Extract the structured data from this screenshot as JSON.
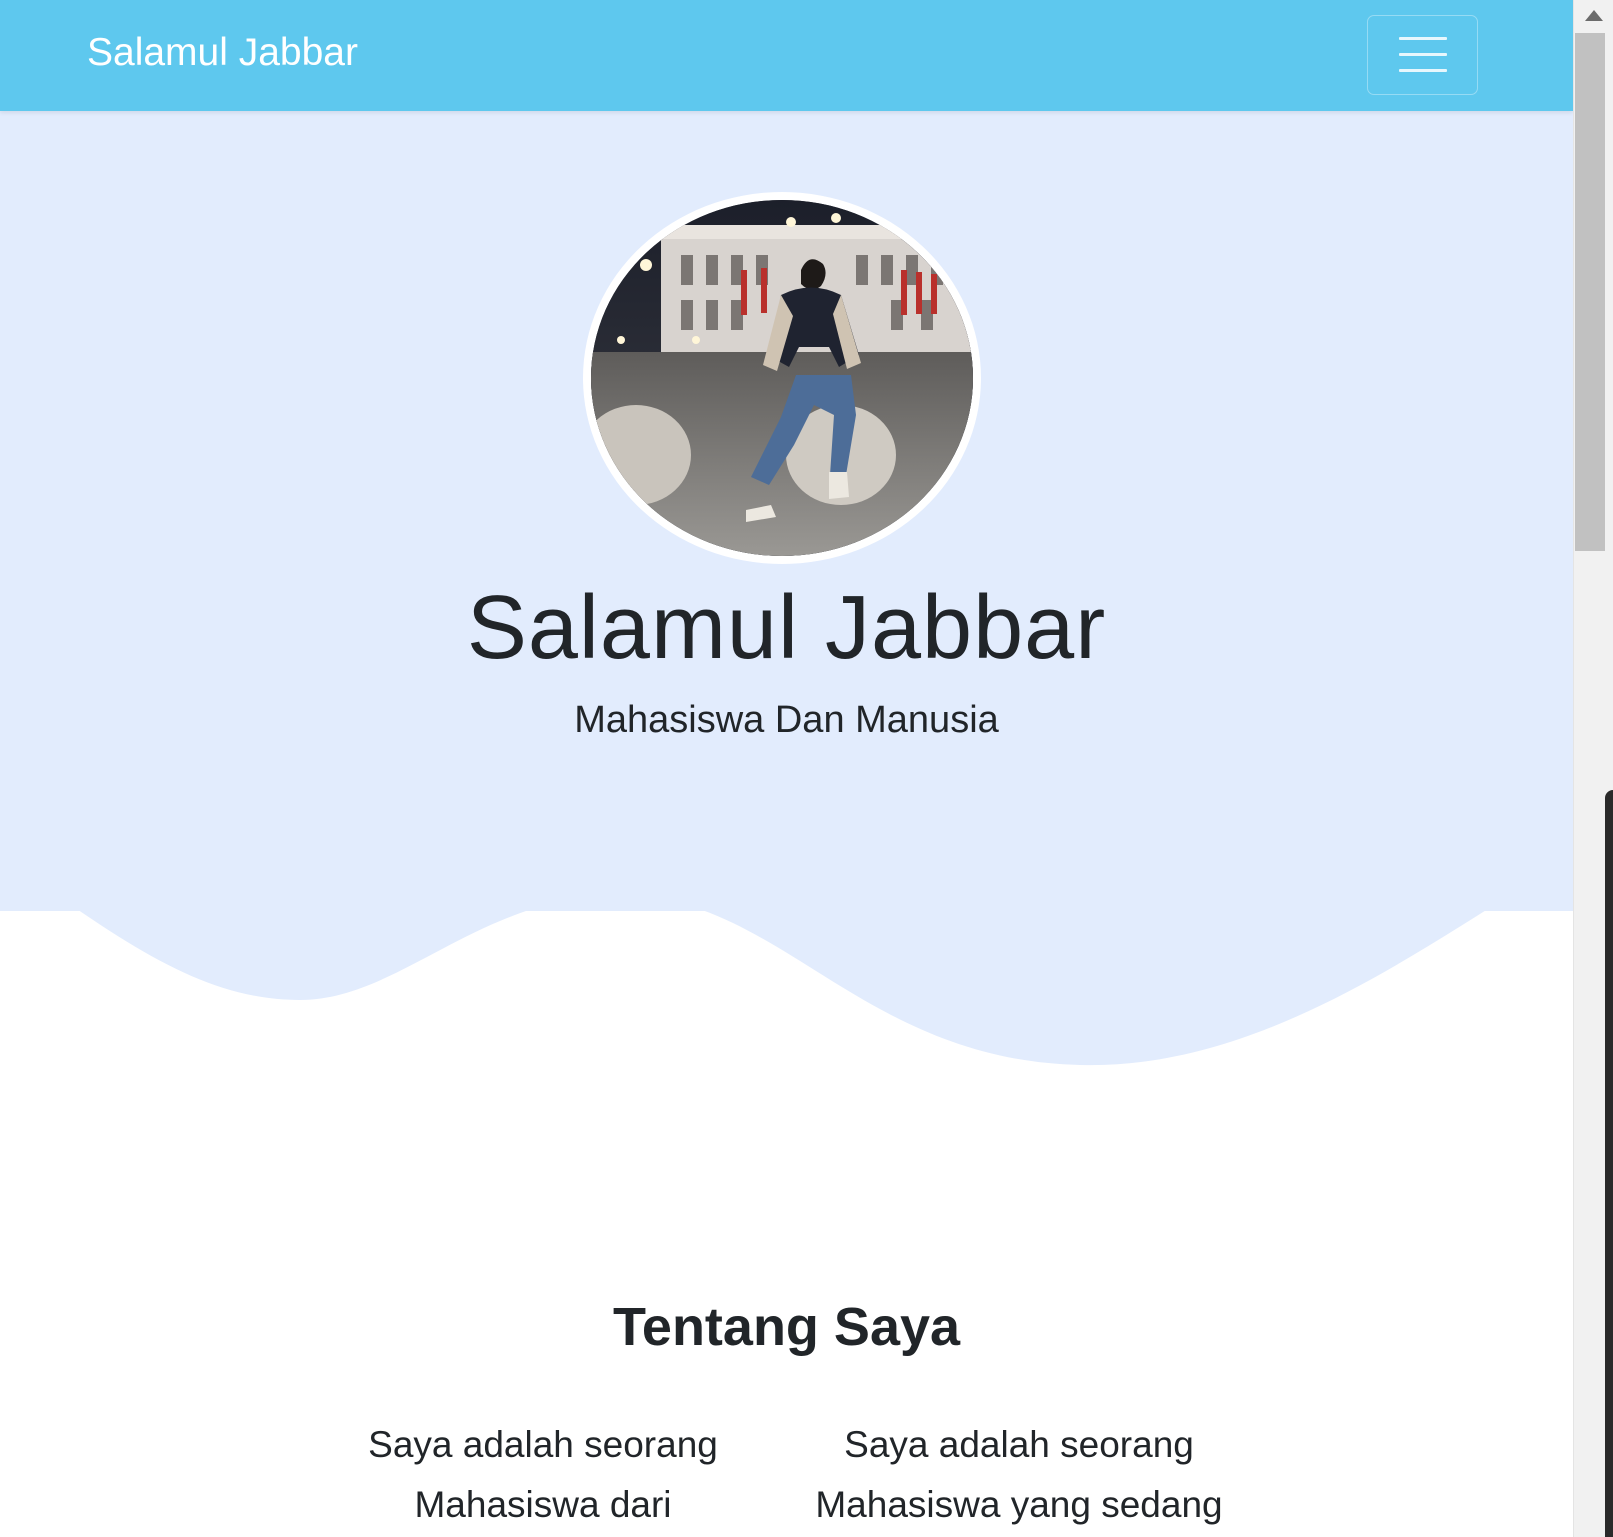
{
  "navbar": {
    "brand": "Salamul Jabbar",
    "toggle_icon": "hamburger-icon",
    "background": "#5ec8ee"
  },
  "hero": {
    "photo_alt": "Foto profil Salamul Jabbar",
    "name": "Salamul Jabbar",
    "tagline": "Mahasiswa Dan Manusia",
    "background": "#e2ecfd"
  },
  "about": {
    "title": "Tentang Saya",
    "col_left": "Saya adalah seorang Mahasiswa dari",
    "col_right": "Saya adalah seorang Mahasiswa yang sedang"
  },
  "scrollbar": {
    "up_icon": "arrow-up-icon"
  }
}
